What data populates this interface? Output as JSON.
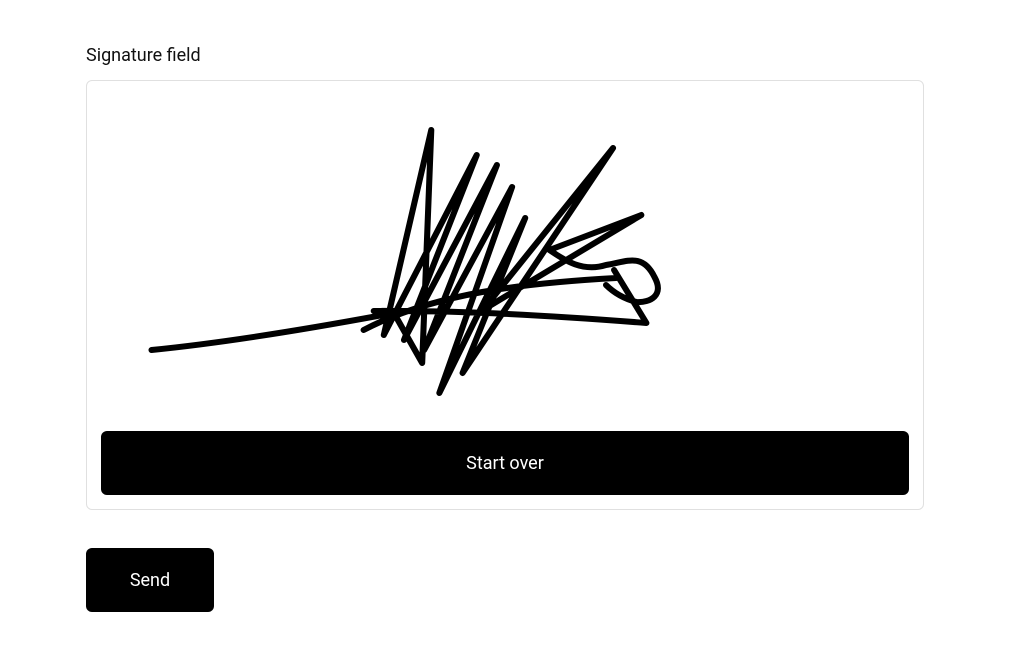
{
  "signature_field": {
    "label": "Signature field",
    "has_signature": true,
    "start_over_label": "Start over"
  },
  "submit": {
    "label": "Send"
  }
}
